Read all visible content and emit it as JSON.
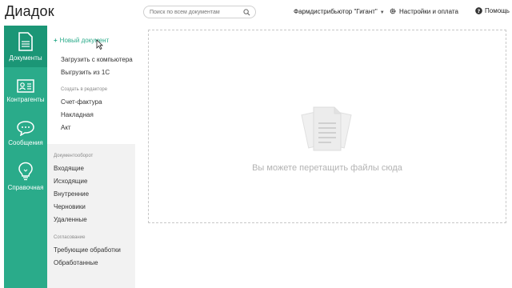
{
  "header": {
    "logo": "Диадок",
    "search_placeholder": "Поиск по всем документам",
    "organization": "Фармдистрибьютор \"Гигант\"",
    "settings_label": "Настройки и оплата",
    "help_label": "Помощь"
  },
  "rail": {
    "items": [
      {
        "label": "Документы",
        "icon": "documents-icon",
        "active": true
      },
      {
        "label": "Контрагенты",
        "icon": "contacts-icon",
        "active": false
      },
      {
        "label": "Сообщения",
        "icon": "chat-icon",
        "active": false
      },
      {
        "label": "Справочная",
        "icon": "lightbulb-icon",
        "active": false
      }
    ]
  },
  "sidebar": {
    "new_document": "Новый документ",
    "upload_computer": "Загрузить с компьютера",
    "upload_1c": "Выгрузить из 1С",
    "editor_header": "Создать в редакторе",
    "editor_items": [
      "Счет-фактура",
      "Накладная",
      "Акт"
    ],
    "docflow_header": "Документооборот",
    "docflow_items": [
      "Входящие",
      "Исходящие",
      "Внутренние",
      "Черновики",
      "Удаленные"
    ],
    "approval_header": "Согласование",
    "approval_items": [
      "Требующие обработки",
      "Обработанные"
    ]
  },
  "dropzone": {
    "text": "Вы можете перетащить файлы сюда"
  },
  "colors": {
    "accent": "#2aab8a",
    "accent_active": "#1b9676"
  }
}
